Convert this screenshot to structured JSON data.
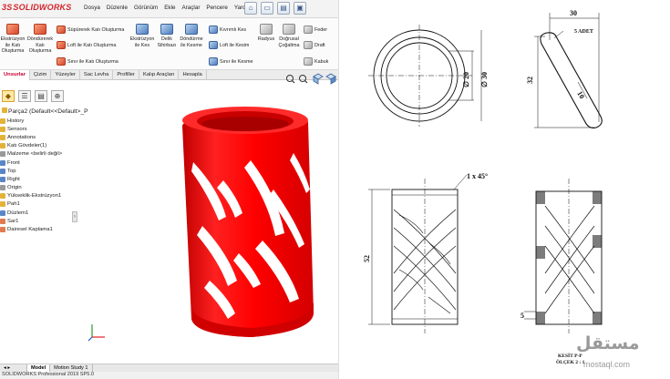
{
  "app": {
    "logo": "SOLIDWORKS",
    "logo_prefix": "3S"
  },
  "menu": [
    "Dosya",
    "Düzenle",
    "Görünüm",
    "Ekle",
    "Araçlar",
    "Pencere",
    "Yardım"
  ],
  "quick_access_icons": [
    "home-icon",
    "new-document-icon",
    "open-folder-icon",
    "save-icon"
  ],
  "ribbon": {
    "extrude_boss": "Ekstrüzyon ile Katı Oluşturma",
    "revolve_boss": "Döndürerek Katı Oluşturma",
    "swept_boss": "Süpürerek Katı Oluşturma",
    "lofted_boss": "Loft ile Katı Oluşturma",
    "boundary_boss": "Sınır ile Katı Oluşturma",
    "extrude_cut": "Ekstrüzyon ile Kes",
    "hole_wizard": "Delik Sihirbazı",
    "revolve_cut": "Döndürme ile Kesme",
    "swept_cut": "Kıvrımlı Kes",
    "lofted_cut": "Loft ile Kesim",
    "boundary_cut": "Sınır ile Kesme",
    "fillet": "Radyus",
    "linear_pattern": "Doğrusal Çoğaltma",
    "rib": "Feder",
    "draft": "Draft",
    "shell": "Kabuk"
  },
  "tabs": [
    "Unsurlar",
    "Çizim",
    "Yüzeyler",
    "Sac Levha",
    "Profiller",
    "Kalıp Araçları",
    "Hesapla"
  ],
  "feature_tree": {
    "part_name": "Parça2 (Default<<Default>_P",
    "items": [
      "History",
      "Sensors",
      "Annotations",
      "Katı Gövdeler(1)",
      "Malzeme <belirli değil>",
      "Front",
      "Top",
      "Right",
      "Origin",
      "Yükseklik-Ekstrüzyon1",
      "Pah1",
      "Düzlem1",
      "Sar1",
      "Dairesel Kaplama1"
    ]
  },
  "bottom_tabs": [
    "Model",
    "Motion Study 1"
  ],
  "status_text": "SOLIDWORKS Professional 2019 SP5.0",
  "drawing": {
    "dim_width": "30",
    "dim_count": "5 ADET",
    "dim_height_small": "32",
    "dim_slot": "10",
    "dim_inner_dia": "∅ 20",
    "dim_outer_dia": "∅ 30",
    "dim_chamfer": "1 x 45°",
    "dim_height": "52",
    "dim_section_thickness": "5",
    "section_title": "KESİT P-P",
    "section_scale": "ÖLÇEK 2 : 1"
  },
  "watermark": {
    "arabic": "مستقل",
    "latin": "mostaql.com"
  },
  "colors": {
    "part_red": "#ff0000",
    "brand_red": "#d4252b",
    "tab_red": "#cc0033"
  }
}
